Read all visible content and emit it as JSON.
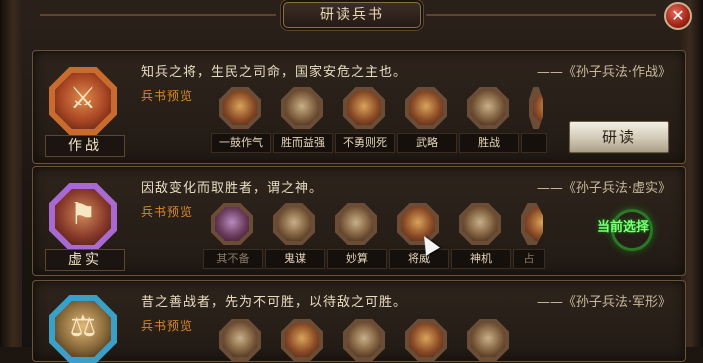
{
  "window": {
    "title": "研读兵书",
    "close_glyph": "✕"
  },
  "strategies": [
    {
      "name": "作战",
      "emblem_glyph": "⚔",
      "quote": "知兵之将，生民之司命，国家安危之主也。",
      "source": "——《孙子兵法·作战》",
      "preview_label": "兵书预览",
      "books": [
        "一鼓作气",
        "胜而益强",
        "不勇则死",
        "武略",
        "胜战",
        ""
      ],
      "action_label": "研读"
    },
    {
      "name": "虚实",
      "emblem_glyph": "⚑",
      "quote": "因敌变化而取胜者，谓之神。",
      "source": "——《孙子兵法·虚实》",
      "preview_label": "兵书预览",
      "books": [
        "其不备",
        "鬼谋",
        "妙算",
        "将威",
        "神机",
        "占"
      ],
      "status_label": "当前选择"
    },
    {
      "name": "",
      "emblem_glyph": "⚖",
      "quote": "昔之善战者，先为不可胜，以待敌之可胜。",
      "source": "——《孙子兵法·军形》",
      "preview_label": "兵书预览",
      "books": [
        "",
        "",
        "",
        "",
        ""
      ]
    }
  ],
  "colors": {
    "accent_orange": "#d98a2a",
    "selected_green": "#7dff7a",
    "close_red": "#a12418"
  },
  "icons": [
    "close-icon",
    "crossed-swords-icon",
    "banner-icon",
    "scroll-icon",
    "cursor-icon"
  ]
}
